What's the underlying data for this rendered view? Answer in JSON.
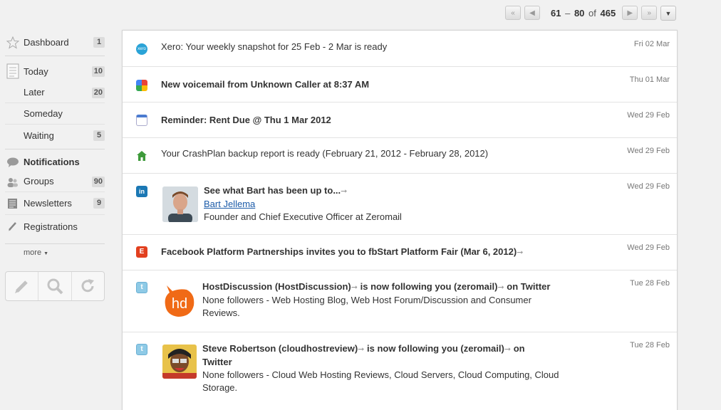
{
  "pager": {
    "range_start": "61",
    "range_sep": "–",
    "range_end": "80",
    "of": "of",
    "total": "465"
  },
  "sidebar": {
    "items": [
      {
        "label": "Dashboard",
        "count": "1"
      },
      {
        "label": "Today",
        "count": "10"
      },
      {
        "label": "Later",
        "count": "20"
      },
      {
        "label": "Someday",
        "count": ""
      },
      {
        "label": "Waiting",
        "count": "5"
      },
      {
        "label": "Notifications",
        "count": ""
      },
      {
        "label": "Groups",
        "count": "90"
      },
      {
        "label": "Newsletters",
        "count": "9"
      },
      {
        "label": "Registrations",
        "count": ""
      }
    ],
    "more": "more"
  },
  "messages": [
    {
      "source": "xero-icon",
      "subject": "Xero: Your weekly snapshot for 25 Feb - 2 Mar is ready",
      "date": "Fri 02 Mar"
    },
    {
      "source": "google-voice-icon",
      "subject": "New voicemail from Unknown Caller at 8:37 AM",
      "date": "Thu 01 Mar"
    },
    {
      "source": "calendar-icon",
      "subject": "Reminder: Rent Due @ Thu 1 Mar 2012",
      "date": "Wed 29 Feb"
    },
    {
      "source": "crashplan-icon",
      "subject": "Your CrashPlan backup report is ready (February 21, 2012 - February 28, 2012)",
      "date": "Wed 29 Feb"
    },
    {
      "source": "linkedin-icon",
      "title": "See what Bart has been up to...",
      "name_link": "Bart Jellema",
      "detail": "Founder and Chief Executive Officer at Zeromail",
      "date": "Wed 29 Feb"
    },
    {
      "source": "facebook-events-icon",
      "subject": "Facebook Platform Partnerships invites you to fbStart Platform Fair (Mar 6, 2012)",
      "date": "Wed 29 Feb"
    },
    {
      "source": "twitter-icon",
      "title_a": "HostDiscussion (HostDiscussion)",
      "title_b": "is now following you (zeromail)",
      "title_c": "on Twitter",
      "detail1": "None followers - Web Hosting Blog, Web Host Forum/Discussion and Consumer",
      "detail2": "Reviews.",
      "date": "Tue 28 Feb"
    },
    {
      "source": "twitter-icon",
      "title_a": "Steve Robertson (cloudhostreview)",
      "title_b": "is now following you (zeromail)",
      "title_c": "on",
      "title_d": "Twitter",
      "detail1": "None followers - Cloud Web Hosting Reviews, Cloud Servers, Cloud Computing, Cloud",
      "detail2": "Storage.",
      "date": "Tue 28 Feb"
    }
  ],
  "avatar_text": "hd"
}
